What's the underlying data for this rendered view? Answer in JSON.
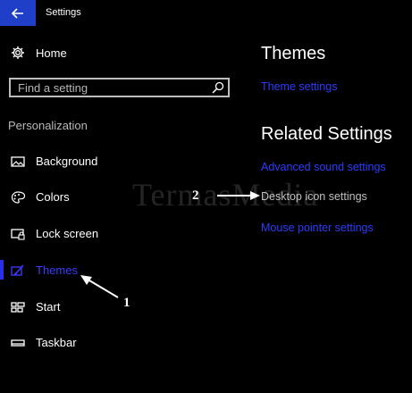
{
  "window": {
    "title": "Settings"
  },
  "sidebar": {
    "home_label": "Home",
    "search_placeholder": "Find a setting",
    "section_header": "Personalization",
    "items": [
      {
        "label": "Background",
        "icon": "picture-icon"
      },
      {
        "label": "Colors",
        "icon": "palette-icon"
      },
      {
        "label": "Lock screen",
        "icon": "lock-screen-icon"
      },
      {
        "label": "Themes",
        "icon": "brush-icon",
        "active": true
      },
      {
        "label": "Start",
        "icon": "start-icon"
      },
      {
        "label": "Taskbar",
        "icon": "taskbar-icon"
      }
    ]
  },
  "main": {
    "themes_heading": "Themes",
    "theme_settings_link": "Theme settings",
    "related_heading": "Related Settings",
    "related_links": [
      "Advanced sound settings",
      "Desktop icon settings",
      "Mouse pointer settings"
    ]
  },
  "annotations": {
    "step1": "1",
    "step2": "2",
    "watermark": "TermasMedia"
  },
  "colors": {
    "accent": "#2b3cff",
    "back_button": "#1f3fc8",
    "background": "#000000"
  }
}
